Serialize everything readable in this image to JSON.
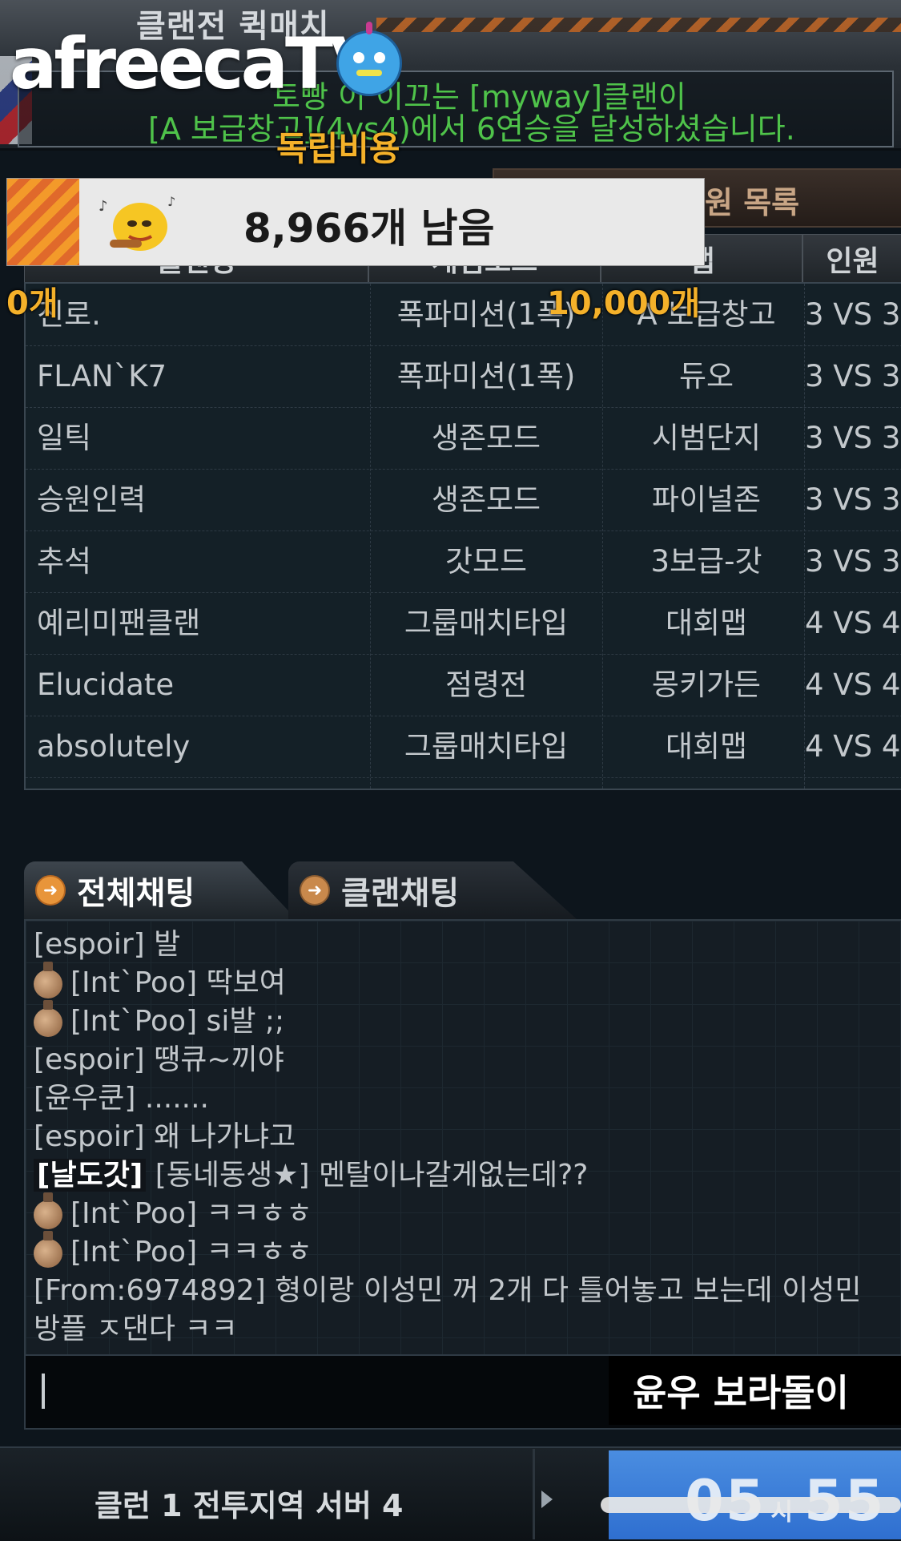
{
  "header": {
    "title": "클랜전 퀵매치",
    "logo": "afreecaTV",
    "notice_line1": "토빵 이 이끄는 [myway]클랜이",
    "notice_line2": "[A 보급창고](4vs4)에서 6연승을 달성하셨습니다."
  },
  "donation": {
    "title": "독립비용",
    "remaining": "8,966개 남음",
    "min": "0개",
    "max": "10,000개",
    "progress_fraction": 0.1034
  },
  "room_list": {
    "header": "원 목록",
    "columns": [
      "클랜명",
      "게임모드",
      "맵",
      "인원"
    ],
    "rows": [
      {
        "clan": "진로.",
        "mode": "폭파미션(1폭)",
        "map": "A 보급창고",
        "people": "3 VS 3"
      },
      {
        "clan": "FLAN`K7",
        "mode": "폭파미션(1폭)",
        "map": "듀오",
        "people": "3 VS 3"
      },
      {
        "clan": "일틱",
        "mode": "생존모드",
        "map": "시범단지",
        "people": "3 VS 3"
      },
      {
        "clan": "승원인력",
        "mode": "생존모드",
        "map": "파이널존",
        "people": "3 VS 3"
      },
      {
        "clan": "추석",
        "mode": "갓모드",
        "map": "3보급-갓",
        "people": "3 VS 3"
      },
      {
        "clan": "예리미팬클랜",
        "mode": "그룹매치타입",
        "map": "대회맵",
        "people": "4 VS 4"
      },
      {
        "clan": "Elucidate",
        "mode": "점령전",
        "map": "몽키가든",
        "people": "4 VS 4"
      },
      {
        "clan": "absolutely",
        "mode": "그룹매치타입",
        "map": "대회맵",
        "people": "4 VS 4"
      }
    ]
  },
  "chat": {
    "tabs": [
      "전체채팅",
      "클랜채팅"
    ],
    "messages": [
      {
        "medal": false,
        "tag": "",
        "text": "[espoir] 발"
      },
      {
        "medal": true,
        "tag": "",
        "text": "[Int`Poo] 딱보여"
      },
      {
        "medal": true,
        "tag": "",
        "text": "[Int`Poo] si발 ;;"
      },
      {
        "medal": false,
        "tag": "",
        "text": "[espoir] 땡큐~끼야"
      },
      {
        "medal": false,
        "tag": "",
        "text": "[윤우쿤] ......."
      },
      {
        "medal": false,
        "tag": "",
        "text": "[espoir] 왜 나가냐고"
      },
      {
        "medal": false,
        "tag": "[날도갓]",
        "text": "[동네동생★] 멘탈이나갈게없는데??"
      },
      {
        "medal": true,
        "tag": "",
        "text": "[Int`Poo] ㅋㅋㅎㅎ"
      },
      {
        "medal": true,
        "tag": "",
        "text": "[Int`Poo] ㅋㅋㅎㅎ"
      },
      {
        "medal": false,
        "tag": "",
        "text": "[From:6974892] 형이랑 이성민 꺼 2개 다 틀어놓고 보는데 이성민 방플 ㅈ댄다 ㅋㅋ"
      }
    ]
  },
  "overlay_name": "윤우 보라돌이",
  "bottom": {
    "server": "클런 1 전투지역 서버 4",
    "clock_hour": "05",
    "clock_unit": "시",
    "clock_minute": "55"
  }
}
